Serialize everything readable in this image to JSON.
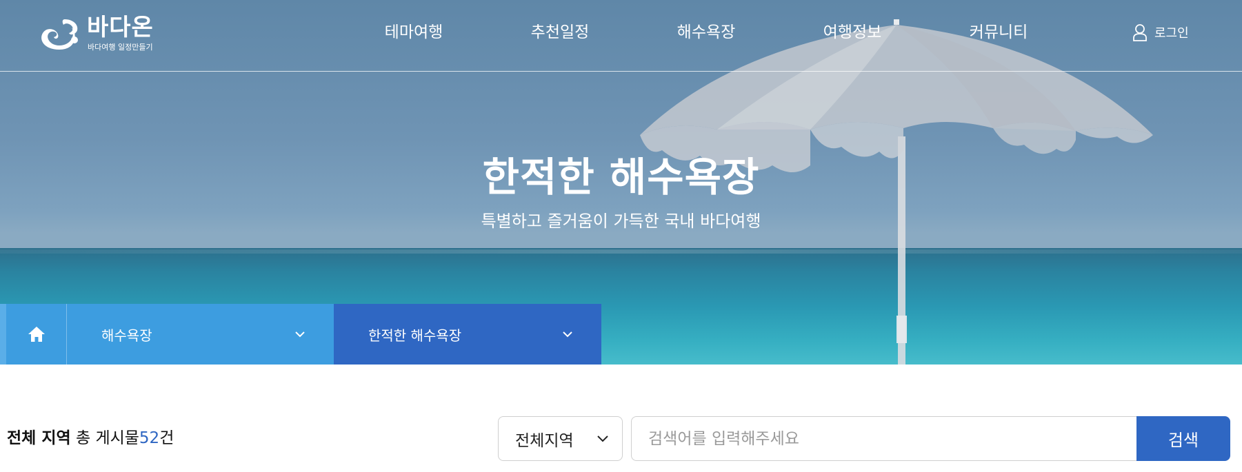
{
  "brand": {
    "name": "바다온",
    "tagline": "바다여행 일정만들기"
  },
  "nav": {
    "items": [
      {
        "label": "테마여행"
      },
      {
        "label": "추천일정"
      },
      {
        "label": "해수욕장"
      },
      {
        "label": "여행정보"
      },
      {
        "label": "커뮤니티"
      }
    ],
    "login_label": "로그인"
  },
  "hero": {
    "title": "한적한 해수욕장",
    "subtitle": "특별하고 즐거움이 가득한 국내 바다여행"
  },
  "location": {
    "home_icon": "home-icon",
    "level1": "해수욕장",
    "level2": "한적한 해수욕장"
  },
  "board": {
    "region_label": "전체 지역",
    "total_prefix": "총 게시물",
    "count": "52",
    "unit": "건"
  },
  "search": {
    "region_value": "전체지역",
    "placeholder": "검색어를 입력해주세요",
    "button_label": "검색"
  },
  "colors": {
    "primary_blue": "#2f67c3",
    "light_blue": "#3d9de0",
    "count_blue": "#2e66c2"
  }
}
